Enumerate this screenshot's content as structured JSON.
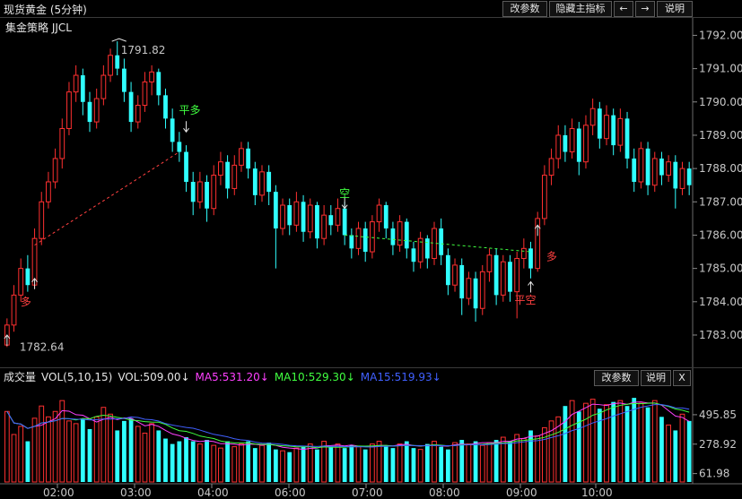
{
  "header": {
    "title": "现货黄金 (5分钟)",
    "buttons": [
      "改参数",
      "隐藏主指标",
      "←",
      "→",
      "说明"
    ]
  },
  "strategy_label": "集金策略 JJCL",
  "annotations": {
    "high": "1791.82",
    "low": "1782.64",
    "signals": [
      {
        "text": "多",
        "color": "#ff4040"
      },
      {
        "text": "平多",
        "color": "#40ff40"
      },
      {
        "text": "空",
        "color": "#40ff40"
      },
      {
        "text": "平空",
        "color": "#ff4040"
      },
      {
        "text": "多",
        "color": "#ff4040"
      }
    ]
  },
  "volume_panel": {
    "label": "成交量",
    "params": "VOL(5,10,15)",
    "vol": "VOL:509.00↓",
    "ma5": "MA5:531.20↓",
    "ma10": "MA10:529.30↓",
    "ma15": "MA15:519.93↓",
    "buttons": [
      "改参数",
      "说明",
      "X"
    ],
    "colors": {
      "vol": "#e6e6e6",
      "ma5": "#ff40ff",
      "ma10": "#40ff40",
      "ma15": "#4060ff"
    }
  },
  "chart_data": {
    "type": "candlestick",
    "price_axis": {
      "ticks": [
        "1792.00",
        "1791.00",
        "1790.00",
        "1789.00",
        "1788.00",
        "1787.00",
        "1786.00",
        "1785.00",
        "1784.00",
        "1783.00"
      ],
      "min": 1782.3,
      "max": 1792.4
    },
    "time_axis": [
      "02:00",
      "03:00",
      "04:00",
      "06:00",
      "07:00",
      "08:00",
      "09:00",
      "10:00"
    ],
    "volume_axis": {
      "ticks": [
        "495.85",
        "278.92",
        "61.98"
      ],
      "max": 700
    },
    "colors": {
      "up": "#ff3030",
      "down": "#30ffff",
      "background": "#000000"
    },
    "candles": [
      [
        1782.7,
        1783.3,
        1782.64,
        1783.5
      ],
      [
        1783.3,
        1784.2,
        1783.1,
        1784.5
      ],
      [
        1784.2,
        1785.0,
        1784.0,
        1785.3
      ],
      [
        1785.0,
        1784.5,
        1784.3,
        1785.4
      ],
      [
        1784.5,
        1785.9,
        1784.4,
        1786.2
      ],
      [
        1785.9,
        1787.0,
        1785.7,
        1787.3
      ],
      [
        1787.0,
        1787.6,
        1786.8,
        1787.9
      ],
      [
        1787.6,
        1788.3,
        1787.4,
        1788.6
      ],
      [
        1788.3,
        1789.2,
        1788.0,
        1789.5
      ],
      [
        1789.2,
        1790.3,
        1789.0,
        1790.6
      ],
      [
        1790.3,
        1790.8,
        1790.0,
        1791.1
      ],
      [
        1790.8,
        1790.0,
        1789.6,
        1791.0
      ],
      [
        1790.0,
        1789.4,
        1789.1,
        1790.3
      ],
      [
        1789.4,
        1790.1,
        1789.2,
        1790.4
      ],
      [
        1790.1,
        1790.8,
        1789.9,
        1791.1
      ],
      [
        1790.8,
        1791.4,
        1790.6,
        1791.6
      ],
      [
        1791.4,
        1791.0,
        1790.8,
        1791.82
      ],
      [
        1791.0,
        1790.3,
        1790.0,
        1791.3
      ],
      [
        1790.3,
        1789.4,
        1789.1,
        1790.6
      ],
      [
        1789.4,
        1789.9,
        1789.2,
        1790.2
      ],
      [
        1789.9,
        1790.6,
        1789.7,
        1790.9
      ],
      [
        1790.6,
        1790.9,
        1790.2,
        1791.1
      ],
      [
        1790.9,
        1790.2,
        1789.9,
        1791.0
      ],
      [
        1790.2,
        1789.5,
        1789.2,
        1790.4
      ],
      [
        1789.5,
        1788.8,
        1788.5,
        1789.8
      ],
      [
        1788.8,
        1788.5,
        1788.2,
        1789.1
      ],
      [
        1788.5,
        1787.6,
        1787.3,
        1788.7
      ],
      [
        1787.6,
        1787.0,
        1786.6,
        1787.9
      ],
      [
        1787.0,
        1787.6,
        1786.8,
        1787.9
      ],
      [
        1787.6,
        1786.8,
        1786.4,
        1787.8
      ],
      [
        1786.8,
        1787.8,
        1786.6,
        1788.1
      ],
      [
        1787.8,
        1788.2,
        1787.5,
        1788.5
      ],
      [
        1788.2,
        1787.4,
        1787.1,
        1788.4
      ],
      [
        1787.4,
        1788.1,
        1787.2,
        1788.4
      ],
      [
        1788.1,
        1788.6,
        1787.9,
        1788.8
      ],
      [
        1788.6,
        1788.0,
        1787.7,
        1788.8
      ],
      [
        1788.0,
        1787.2,
        1786.9,
        1788.2
      ],
      [
        1787.2,
        1787.9,
        1787.0,
        1788.1
      ],
      [
        1787.9,
        1787.3,
        1786.9,
        1788.1
      ],
      [
        1787.3,
        1786.2,
        1785.0,
        1787.5
      ],
      [
        1786.2,
        1786.9,
        1786.0,
        1787.1
      ],
      [
        1786.9,
        1786.3,
        1786.0,
        1787.1
      ],
      [
        1786.3,
        1787.0,
        1786.1,
        1787.3
      ],
      [
        1787.0,
        1786.1,
        1785.8,
        1787.2
      ],
      [
        1786.1,
        1786.9,
        1785.9,
        1787.1
      ],
      [
        1786.9,
        1785.9,
        1785.6,
        1787.0
      ],
      [
        1785.9,
        1786.6,
        1785.7,
        1786.9
      ],
      [
        1786.6,
        1786.3,
        1786.0,
        1786.9
      ],
      [
        1786.3,
        1786.8,
        1786.1,
        1787.1
      ],
      [
        1786.8,
        1786.0,
        1785.7,
        1787.0
      ],
      [
        1786.0,
        1785.6,
        1785.3,
        1786.2
      ],
      [
        1785.6,
        1786.2,
        1785.4,
        1786.4
      ],
      [
        1786.2,
        1785.5,
        1785.2,
        1786.4
      ],
      [
        1785.5,
        1786.4,
        1785.3,
        1786.6
      ],
      [
        1786.4,
        1786.9,
        1786.1,
        1787.1
      ],
      [
        1786.9,
        1786.2,
        1785.9,
        1787.0
      ],
      [
        1786.2,
        1785.7,
        1785.4,
        1786.4
      ],
      [
        1785.7,
        1786.4,
        1785.5,
        1786.6
      ],
      [
        1786.4,
        1785.6,
        1785.3,
        1786.5
      ],
      [
        1785.6,
        1785.2,
        1784.9,
        1785.8
      ],
      [
        1785.2,
        1785.9,
        1785.0,
        1786.1
      ],
      [
        1785.9,
        1785.3,
        1785.0,
        1786.0
      ],
      [
        1785.3,
        1786.2,
        1785.1,
        1786.4
      ],
      [
        1786.2,
        1785.4,
        1785.1,
        1786.5
      ],
      [
        1785.4,
        1784.5,
        1784.2,
        1785.6
      ],
      [
        1784.5,
        1785.1,
        1784.3,
        1785.3
      ],
      [
        1785.1,
        1784.1,
        1783.6,
        1785.3
      ],
      [
        1784.1,
        1784.7,
        1783.9,
        1784.9
      ],
      [
        1784.7,
        1783.8,
        1783.4,
        1784.9
      ],
      [
        1783.8,
        1784.9,
        1783.6,
        1785.1
      ],
      [
        1784.9,
        1785.4,
        1784.6,
        1785.6
      ],
      [
        1785.4,
        1784.2,
        1783.9,
        1785.6
      ],
      [
        1784.2,
        1785.2,
        1784.0,
        1785.4
      ],
      [
        1785.2,
        1784.3,
        1784.0,
        1785.4
      ],
      [
        1784.3,
        1785.3,
        1783.5,
        1785.5
      ],
      [
        1785.3,
        1785.6,
        1785.0,
        1785.9
      ],
      [
        1785.6,
        1785.0,
        1784.7,
        1785.8
      ],
      [
        1785.0,
        1786.5,
        1784.9,
        1786.7
      ],
      [
        1786.5,
        1787.8,
        1786.3,
        1788.1
      ],
      [
        1787.8,
        1788.3,
        1787.5,
        1788.6
      ],
      [
        1788.3,
        1789.0,
        1788.0,
        1789.3
      ],
      [
        1789.0,
        1788.5,
        1788.2,
        1789.3
      ],
      [
        1788.5,
        1789.2,
        1788.3,
        1789.5
      ],
      [
        1789.2,
        1788.2,
        1787.8,
        1789.4
      ],
      [
        1788.2,
        1789.3,
        1788.0,
        1789.6
      ],
      [
        1789.3,
        1789.8,
        1789.0,
        1790.1
      ],
      [
        1789.8,
        1788.9,
        1788.6,
        1790.0
      ],
      [
        1788.9,
        1789.6,
        1788.7,
        1789.9
      ],
      [
        1789.6,
        1788.7,
        1788.4,
        1789.8
      ],
      [
        1788.7,
        1789.5,
        1788.5,
        1789.8
      ],
      [
        1789.5,
        1788.3,
        1788.0,
        1789.7
      ],
      [
        1788.3,
        1787.6,
        1787.3,
        1788.6
      ],
      [
        1787.6,
        1788.6,
        1787.4,
        1788.8
      ],
      [
        1788.6,
        1787.5,
        1787.2,
        1788.8
      ],
      [
        1787.5,
        1788.3,
        1787.3,
        1788.5
      ],
      [
        1788.3,
        1787.8,
        1787.5,
        1788.5
      ],
      [
        1787.8,
        1788.2,
        1787.6,
        1788.4
      ],
      [
        1788.2,
        1787.4,
        1786.8,
        1788.4
      ],
      [
        1787.4,
        1788.0,
        1787.2,
        1788.2
      ],
      [
        1788.0,
        1787.5,
        1787.2,
        1788.2
      ]
    ],
    "volume": [
      520,
      350,
      410,
      300,
      470,
      560,
      480,
      520,
      600,
      450,
      430,
      460,
      390,
      480,
      550,
      500,
      380,
      450,
      470,
      410,
      360,
      430,
      380,
      320,
      280,
      300,
      330,
      300,
      280,
      310,
      270,
      250,
      300,
      260,
      280,
      300,
      250,
      270,
      290,
      240,
      230,
      220,
      250,
      260,
      280,
      240,
      300,
      260,
      280,
      250,
      270,
      260,
      240,
      280,
      300,
      260,
      250,
      280,
      300,
      250,
      240,
      280,
      300,
      260,
      240,
      290,
      310,
      280,
      300,
      270,
      290,
      310,
      330,
      300,
      350,
      320,
      380,
      340,
      400,
      450,
      480,
      560,
      600,
      520,
      580,
      610,
      540,
      570,
      590,
      600,
      560,
      620,
      580,
      550,
      600,
      480,
      420,
      380,
      500,
      450
    ],
    "signal_positions": [
      {
        "index": 3,
        "type": "buy"
      },
      {
        "index": 26,
        "type": "close-buy"
      },
      {
        "index": 49,
        "type": "sell"
      },
      {
        "index": 76,
        "type": "close-sell"
      },
      {
        "index": 77,
        "type": "buy"
      }
    ]
  }
}
